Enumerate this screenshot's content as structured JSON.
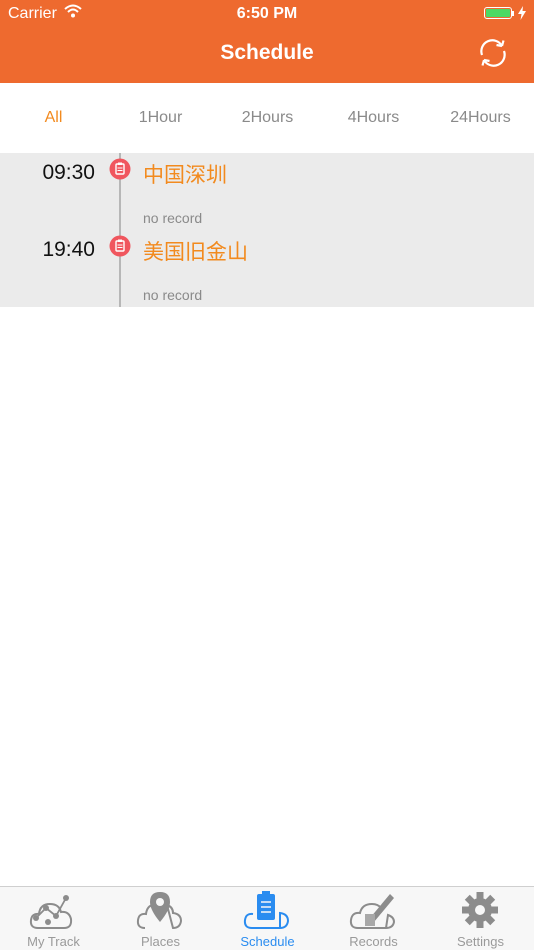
{
  "status_bar": {
    "carrier": "Carrier",
    "time": "6:50 PM"
  },
  "header": {
    "title": "Schedule",
    "refresh_icon": "refresh-icon"
  },
  "filters": [
    {
      "label": "All",
      "active": true
    },
    {
      "label": "1Hour",
      "active": false
    },
    {
      "label": "2Hours",
      "active": false
    },
    {
      "label": "4Hours",
      "active": false
    },
    {
      "label": "24Hours",
      "active": false
    }
  ],
  "schedule": [
    {
      "time": "09:30",
      "place": "中国深圳",
      "record": "no record",
      "icon": "clipboard-icon"
    },
    {
      "time": "19:40",
      "place": "美国旧金山",
      "record": "no record",
      "icon": "clipboard-icon"
    }
  ],
  "tabbar": [
    {
      "label": "My Track",
      "icon": "track-cloud-icon",
      "active": false
    },
    {
      "label": "Places",
      "icon": "place-pin-cloud-icon",
      "active": false
    },
    {
      "label": "Schedule",
      "icon": "clipboard-cloud-icon",
      "active": true
    },
    {
      "label": "Records",
      "icon": "pencil-cloud-icon",
      "active": false
    },
    {
      "label": "Settings",
      "icon": "gear-icon",
      "active": false
    }
  ],
  "colors": {
    "header": "#ee6a2f",
    "accent_orange": "#f28a1e",
    "active_tab": "#2a8cf0",
    "marker_red": "#f0565e"
  }
}
